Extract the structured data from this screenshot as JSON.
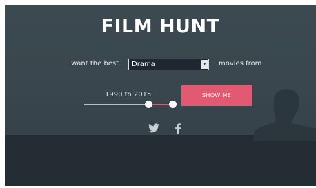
{
  "app": {
    "title": "FILM HUNT"
  },
  "filter": {
    "prefix": "I want the best",
    "genre": "Drama",
    "suffix": "movies from"
  },
  "years": {
    "label": "1990 to 2015",
    "range_start_fraction": 0.73,
    "range_end_fraction": 1.0
  },
  "actions": {
    "show_label": "SHOW ME"
  },
  "social": {
    "icons": [
      "twitter-icon",
      "facebook-icon"
    ]
  },
  "colors": {
    "accent": "#e15a72",
    "background": "#36434a",
    "floor": "#252d34"
  }
}
